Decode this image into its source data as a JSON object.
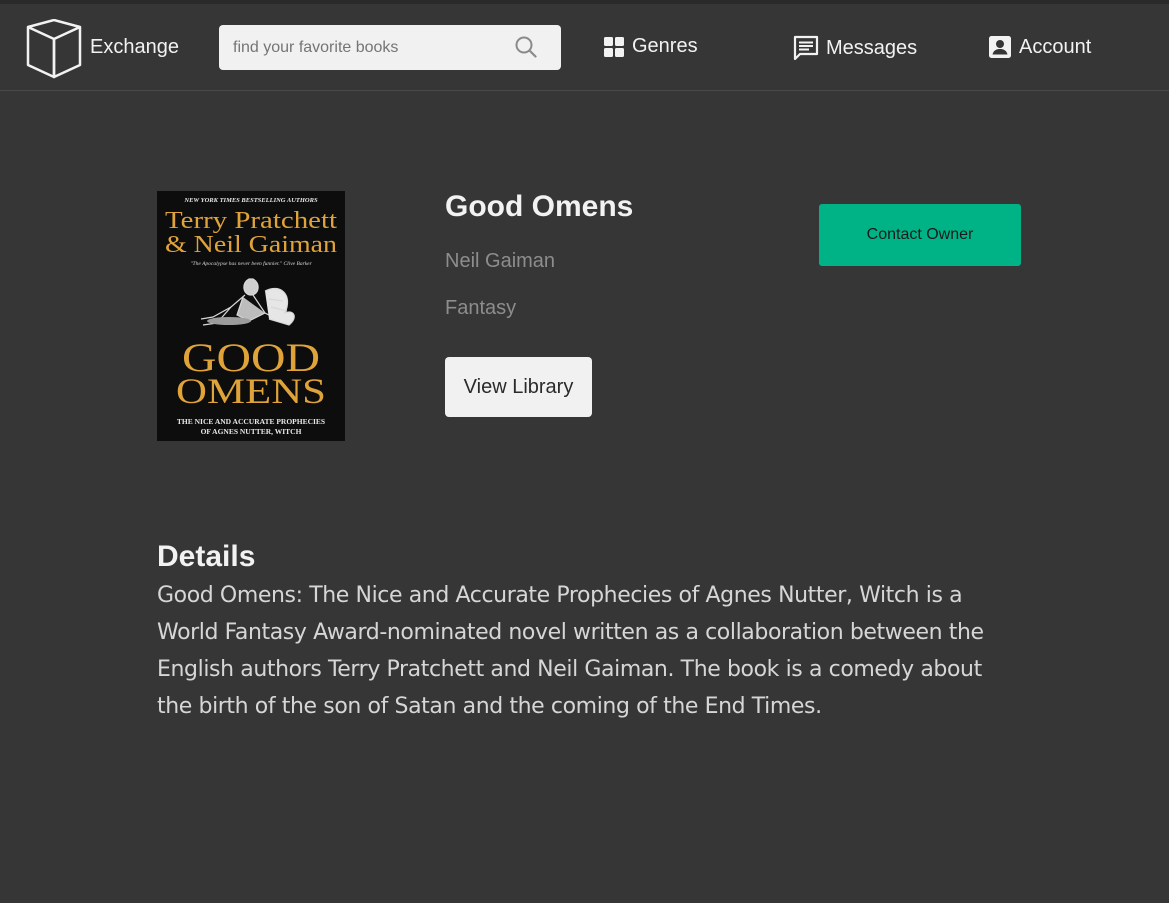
{
  "app": {
    "logo_text": "Exchange"
  },
  "search": {
    "placeholder": "find your favorite books"
  },
  "nav": {
    "genres": "Genres",
    "messages": "Messages",
    "account": "Account"
  },
  "book": {
    "title": "Good Omens",
    "author": "Neil Gaiman",
    "genre": "Fantasy",
    "cover": {
      "tagline": "NEW YORK TIMES BESTSELLING AUTHORS",
      "author_line1": "Terry Pratchett",
      "author_line2": "& Neil Gaiman",
      "quote": "\"The Apocalypse has never been funnier.\" Clive Barker",
      "title_line1": "GOOD",
      "title_line2": "OMENS",
      "subtitle_line1": "THE NICE AND ACCURATE PROPHECIES",
      "subtitle_line2": "OF AGNES NUTTER, WITCH"
    }
  },
  "actions": {
    "view_library": "View Library",
    "contact_owner": "Contact Owner"
  },
  "details": {
    "heading": "Details",
    "body": "Good Omens: The Nice and Accurate Prophecies of Agnes Nutter, Witch is a World Fantasy Award-nominated novel written as a collaboration between the English authors Terry Pratchett and Neil Gaiman. The book is a comedy about the birth of the son of Satan and the coming of the End Times."
  },
  "colors": {
    "background": "#363636",
    "accent": "#00b386",
    "text_primary": "#f2f2f2",
    "text_muted": "#8d8d8d",
    "cover_gold": "#e0a33a"
  }
}
